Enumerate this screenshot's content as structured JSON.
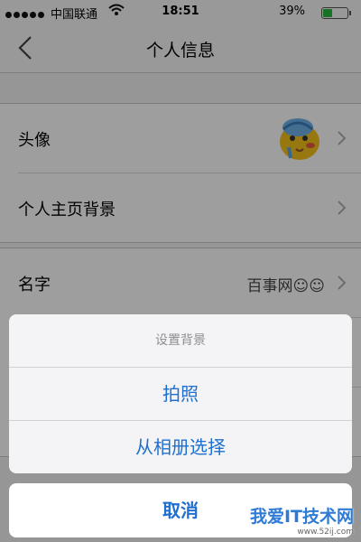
{
  "status": {
    "carrier": "中国联通",
    "time": "18:51",
    "battery": "39%",
    "battery_level": 0.39
  },
  "nav": {
    "title": "个人信息"
  },
  "profile": {
    "avatar_label": "头像",
    "background_label": "个人主页背景",
    "name_label": "名字",
    "name_value": "百事网☺☺"
  },
  "sheet": {
    "title": "设置背景",
    "options": [
      "拍照",
      "从相册选择"
    ],
    "cancel": "取消"
  },
  "watermark": {
    "text": "我爱IT技术网",
    "url": "www.52ij.com"
  },
  "colors": {
    "accent": "#1f6fd0",
    "battery": "#29b63d"
  }
}
